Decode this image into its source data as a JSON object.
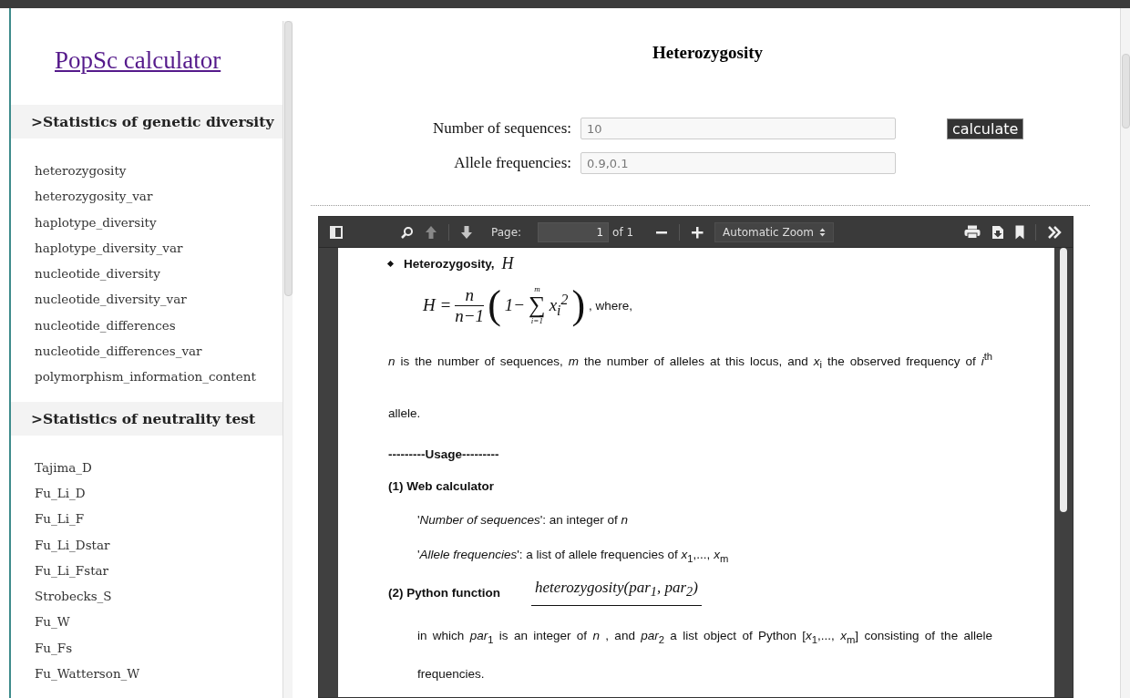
{
  "sidebar": {
    "title": "PopSc calculator",
    "sections": [
      {
        "heading": ">Statistics of genetic diversity",
        "items": [
          "heterozygosity",
          "heterozygosity_var",
          "haplotype_diversity",
          "haplotype_diversity_var",
          "nucleotide_diversity",
          "nucleotide_diversity_var",
          "nucleotide_differences",
          "nucleotide_differences_var",
          "polymorphism_information_content"
        ]
      },
      {
        "heading": ">Statistics of neutrality test",
        "items": [
          "Tajima_D",
          "Fu_Li_D",
          "Fu_Li_F",
          "Fu_Li_Dstar",
          "Fu_Li_Fstar",
          "Strobecks_S",
          "Fu_W",
          "Fu_Fs",
          "Fu_Watterson_W"
        ]
      }
    ]
  },
  "main": {
    "title": "Heterozygosity",
    "fields": [
      {
        "label": "Number of sequences:",
        "placeholder": "10"
      },
      {
        "label": "Allele frequencies:",
        "placeholder": "0.9,0.1"
      }
    ],
    "button": "calculate"
  },
  "pdf_viewer": {
    "toolbar": {
      "previous_disabled": true,
      "next_disabled": false,
      "page_label": "Page:",
      "page_value": "1",
      "page_count": "of 1",
      "zoom": "Automatic Zoom"
    },
    "document": [
      {
        "kind": "bullet",
        "text": "**Heterozygosity,**",
        "math": "H"
      },
      {
        "kind": "formula",
        "lhs": "H =",
        "numerator": "n",
        "denominator": "n−1",
        "open": "(",
        "one": "1−",
        "sum_top": "m",
        "sum": "∑",
        "sum_bottom": "i=1",
        "term": "x$_{i}$$^{2}$",
        "close": ")",
        "suffix": ", where,"
      },
      {
        "kind": "paragraph",
        "text": "*n*  is the number of sequences,  *m*  the number of alleles at this locus, and  *x*$_{i}$  the observed frequency of  *i*$^{th}$  allele."
      },
      {
        "kind": "heading",
        "text": "---------Usage---------"
      },
      {
        "kind": "heading",
        "text": "(1) Web calculator"
      },
      {
        "kind": "indent",
        "text": "'*Number of sequences*':    an integer of  *n*"
      },
      {
        "kind": "indent",
        "text": "'*Allele frequencies*':    a list of allele frequencies of  *x*$_{1}$,..., *x*$_{m}$"
      },
      {
        "kind": "function",
        "text": "(2) Python function",
        "code": "heterozygosity(par$_{1}$, par$_{2}$)"
      },
      {
        "kind": "indent_paragraph",
        "text": "in which  *par*$_{1}$  is an integer of  *n* , and  *par*$_{2}$  a list object of Python  [*x*$_{1}$,..., *x*$_{m}$]  consisting of the allele frequencies."
      }
    ]
  }
}
